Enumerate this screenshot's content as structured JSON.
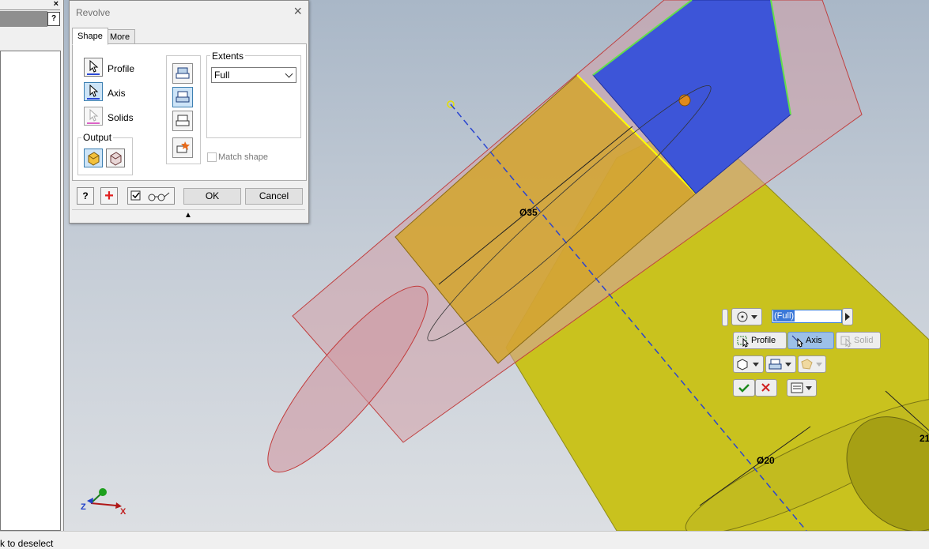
{
  "dialog": {
    "title": "Revolve",
    "tabs": [
      {
        "label": "Shape"
      },
      {
        "label": "More"
      }
    ],
    "selectors": [
      {
        "label": "Profile"
      },
      {
        "label": "Axis"
      },
      {
        "label": "Solids"
      }
    ],
    "output_label": "Output",
    "extents_label": "Extents",
    "extents_value": "Full",
    "match_shape_label": "Match shape",
    "ok_label": "OK",
    "cancel_label": "Cancel",
    "help_glyph": "?",
    "expand_glyph": "▲"
  },
  "browser": {
    "help_glyph": "?",
    "close_glyph": "×"
  },
  "viewport": {
    "dimension_35": "Ø35",
    "dimension_20": "Ø20",
    "dimension_partial": "21",
    "triad": {
      "z": "Z",
      "x": "X"
    }
  },
  "minitoolbar": {
    "extent_value": "(Full)",
    "profile_label": "Profile",
    "axis_label": "Axis",
    "solid_label": "Solid"
  },
  "status": {
    "text": "ck to deselect"
  },
  "colors": {
    "yellow_body": "#c9c21e",
    "blue_face": "#3d55d8",
    "preview_pink": "#d4a0a8",
    "selection_highlight": "#cde4f7"
  }
}
